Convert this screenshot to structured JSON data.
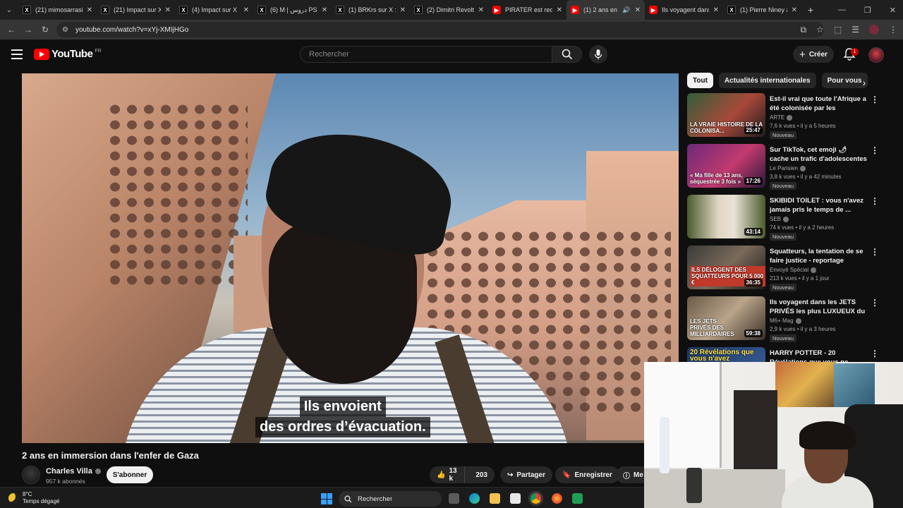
{
  "browser": {
    "tabs": [
      {
        "title": "(21) mimosarrasin",
        "icon": "x-logo-icon"
      },
      {
        "title": "(21) Impact sur X",
        "icon": "x-logo-icon"
      },
      {
        "title": "(4) Impact sur X :",
        "icon": "x-logo-icon"
      },
      {
        "title": "(6) M | دروس PSMA",
        "icon": "x-logo-icon"
      },
      {
        "title": "(1) BRKrs sur X :",
        "icon": "x-logo-icon"
      },
      {
        "title": "(2) Dimitri Revolt",
        "icon": "x-logo-icon"
      },
      {
        "title": "PIRATER est redev",
        "icon": "youtube-icon"
      },
      {
        "title": "(1) 2 ans en im",
        "icon": "youtube-icon",
        "active": true,
        "audio": true
      },
      {
        "title": "Ils voyagent dans",
        "icon": "youtube-icon"
      },
      {
        "title": "(1) Pierre Niney a",
        "icon": "x-logo-icon"
      }
    ],
    "new_tab_label": "+",
    "url": "youtube.com/watch?v=xYj-XMIjHGo"
  },
  "masthead": {
    "logo_text": "YouTube",
    "region": "FR",
    "search_placeholder": "Rechercher",
    "create_label": "Créer",
    "notification_count": "1"
  },
  "player": {
    "subtitle_line1": "Ils envoient",
    "subtitle_line2": "des ordres d’évacuation."
  },
  "video": {
    "title": "2 ans en immersion dans l'enfer de Gaza",
    "channel": "Charles Villa",
    "subscribers": "957 k abonnés",
    "subscribe_label": "S'abonner",
    "likes": "13 k",
    "comments": "203",
    "share_label": "Partager",
    "save_label": "Enregistrer",
    "more_label": "Me"
  },
  "chips": [
    {
      "label": "Tout",
      "active": true
    },
    {
      "label": "Actualités internationales"
    },
    {
      "label": "Pour vous"
    }
  ],
  "recommendations": [
    {
      "title": "Est-il vrai que toute l'Afrique a été colonisée par les Européen...",
      "channel": "ARTE",
      "meta": "7,6 k vues • il y a 5 heures",
      "badge": "Nouveau",
      "duration": "25:47",
      "thumb_text": "LA VRAIE HISTOIRE DE LA COLONISA..."
    },
    {
      "title": "Sur TikTok, cet emoji 🌶 cache un trafic d'adolescentes",
      "channel": "Le Parisien",
      "meta": "3,8 k vues • il y a 42 minutes",
      "badge": "Nouveau",
      "duration": "17:26",
      "thumb_text": "« Ma fille de 13 ans, séquestrée 3 fois »"
    },
    {
      "title": "SKIBIDI TOILET : vous n'avez jamais pris le temps de ...",
      "channel": "SEB",
      "meta": "74 k vues • il y a 2 heures",
      "badge": "Nouveau",
      "duration": "43:14",
      "thumb_text": ""
    },
    {
      "title": "Squatteurs, la tentation de se faire justice - reportage intégral",
      "channel": "Envoyé Spécial",
      "meta": "213 k vues • il y a 1 jour",
      "badge": "Nouveau",
      "duration": "36:35",
      "thumb_text": "ILS DÉLOGENT DES SQUATTEURS POUR 5 000 €"
    },
    {
      "title": "Ils voyagent dans les JETS PRIVÉS les plus LUXUEUX du ...",
      "channel": "M6+ Mag",
      "meta": "2,9 k vues • il y a 3 heures",
      "badge": "Nouveau",
      "duration": "59:38",
      "thumb_text": "LES JETS PRIVÉS DES MILLIARDAIRES"
    },
    {
      "title": "HARRY POTTER - 20 Révélations que vous ne...",
      "channel": "",
      "meta": "",
      "badge": "",
      "duration": "",
      "thumb_text": "20 Révélations que vous n'avez"
    }
  ],
  "taskbar": {
    "temperature": "8°C",
    "weather": "Temps dégagé",
    "search_label": "Rechercher"
  },
  "colors": {
    "background": "#0f0f0f",
    "accent_red": "#ff0000",
    "chip_bg": "#272727"
  }
}
